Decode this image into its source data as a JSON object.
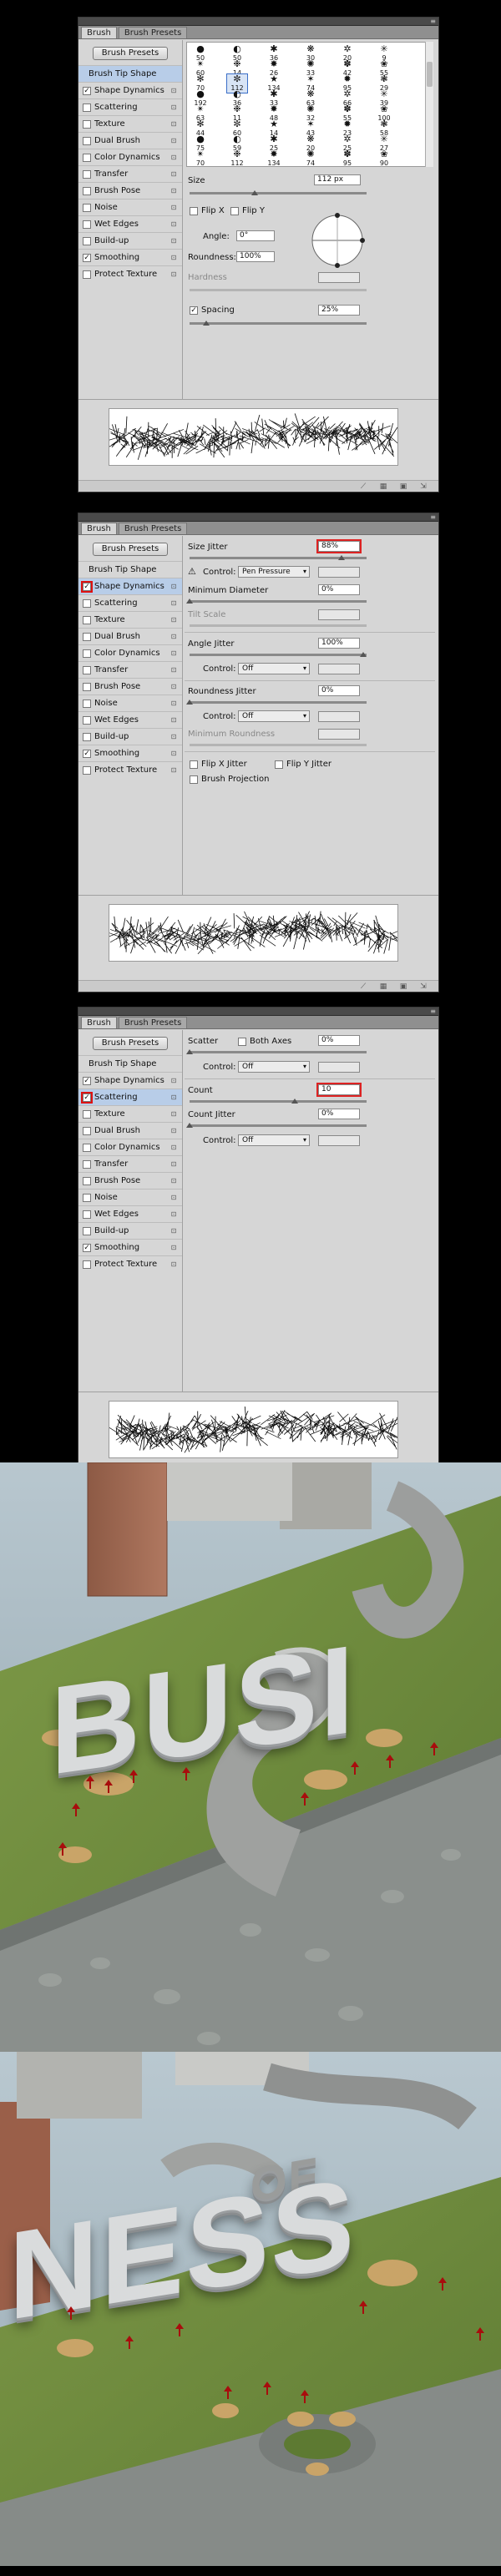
{
  "panel_common": {
    "tab_brush": "Brush",
    "tab_presets": "Brush Presets",
    "presets_button": "Brush Presets",
    "options": [
      "Brush Tip Shape",
      "Shape Dynamics",
      "Scattering",
      "Texture",
      "Dual Brush",
      "Color Dynamics",
      "Transfer",
      "Brush Pose",
      "Noise",
      "Wet Edges",
      "Build-up",
      "Smoothing",
      "Protect Texture"
    ]
  },
  "panel1": {
    "checked": [
      false,
      true,
      false,
      false,
      false,
      false,
      false,
      false,
      false,
      false,
      false,
      true,
      false
    ],
    "tips": [
      {
        "n": "50"
      },
      {
        "n": "50"
      },
      {
        "n": "36"
      },
      {
        "n": "30"
      },
      {
        "n": "20"
      },
      {
        "n": "9"
      },
      {
        "n": "60"
      },
      {
        "n": "14"
      },
      {
        "n": "26"
      },
      {
        "n": "33"
      },
      {
        "n": "42"
      },
      {
        "n": "55"
      },
      {
        "n": "70"
      },
      {
        "n": "112"
      },
      {
        "n": "134"
      },
      {
        "n": "74"
      },
      {
        "n": "95"
      },
      {
        "n": "29"
      },
      {
        "n": "192"
      },
      {
        "n": "36"
      },
      {
        "n": "33"
      },
      {
        "n": "63"
      },
      {
        "n": "66"
      },
      {
        "n": "39"
      },
      {
        "n": "63"
      },
      {
        "n": "11"
      },
      {
        "n": "48"
      },
      {
        "n": "32"
      },
      {
        "n": "55"
      },
      {
        "n": "100"
      },
      {
        "n": "44"
      },
      {
        "n": "60"
      },
      {
        "n": "14"
      },
      {
        "n": "43"
      },
      {
        "n": "23"
      },
      {
        "n": "58"
      },
      {
        "n": "75"
      },
      {
        "n": "59"
      },
      {
        "n": "25"
      },
      {
        "n": "20"
      },
      {
        "n": "25"
      },
      {
        "n": "27"
      },
      {
        "n": "70"
      },
      {
        "n": "112"
      },
      {
        "n": "134"
      },
      {
        "n": "74"
      },
      {
        "n": "95"
      },
      {
        "n": "90"
      }
    ],
    "size_label": "Size",
    "size_value": "112 px",
    "flip_x": "Flip X",
    "flip_y": "Flip Y",
    "angle_label": "Angle:",
    "angle_value": "0°",
    "roundness_label": "Roundness:",
    "roundness_value": "100%",
    "hardness_label": "Hardness",
    "spacing_label": "Spacing",
    "spacing_value": "25%"
  },
  "panel2": {
    "checked": [
      false,
      true,
      false,
      false,
      false,
      false,
      false,
      false,
      false,
      false,
      false,
      true,
      false
    ],
    "size_jitter_label": "Size Jitter",
    "size_jitter_value": "88%",
    "control_label": "Control:",
    "control_pen": "Pen Pressure",
    "min_diameter_label": "Minimum Diameter",
    "min_diameter_value": "0%",
    "tilt_scale_label": "Tilt Scale",
    "angle_jitter_label": "Angle Jitter",
    "angle_jitter_value": "100%",
    "control_off": "Off",
    "roundness_jitter_label": "Roundness Jitter",
    "roundness_jitter_value": "0%",
    "min_roundness_label": "Minimum Roundness",
    "flip_x_jitter": "Flip X Jitter",
    "flip_y_jitter": "Flip Y Jitter",
    "brush_projection": "Brush Projection"
  },
  "panel3": {
    "checked": [
      false,
      true,
      true,
      false,
      false,
      false,
      false,
      false,
      false,
      false,
      false,
      true,
      false
    ],
    "scatter_label": "Scatter",
    "both_axes": "Both Axes",
    "scatter_value": "0%",
    "control_label": "Control:",
    "control_off": "Off",
    "count_label": "Count",
    "count_value": "10",
    "count_jitter_label": "Count Jitter",
    "count_jitter_value": "0%"
  },
  "scene1": {
    "word": "BUSI"
  },
  "scene2": {
    "word": "NESS",
    "word_small": "OF"
  },
  "colors": {
    "panel_bg": "#d6d6d6",
    "highlight": "#b8cde8",
    "arrow_red": "#a80d0d",
    "grass": "#6f8a3c"
  }
}
